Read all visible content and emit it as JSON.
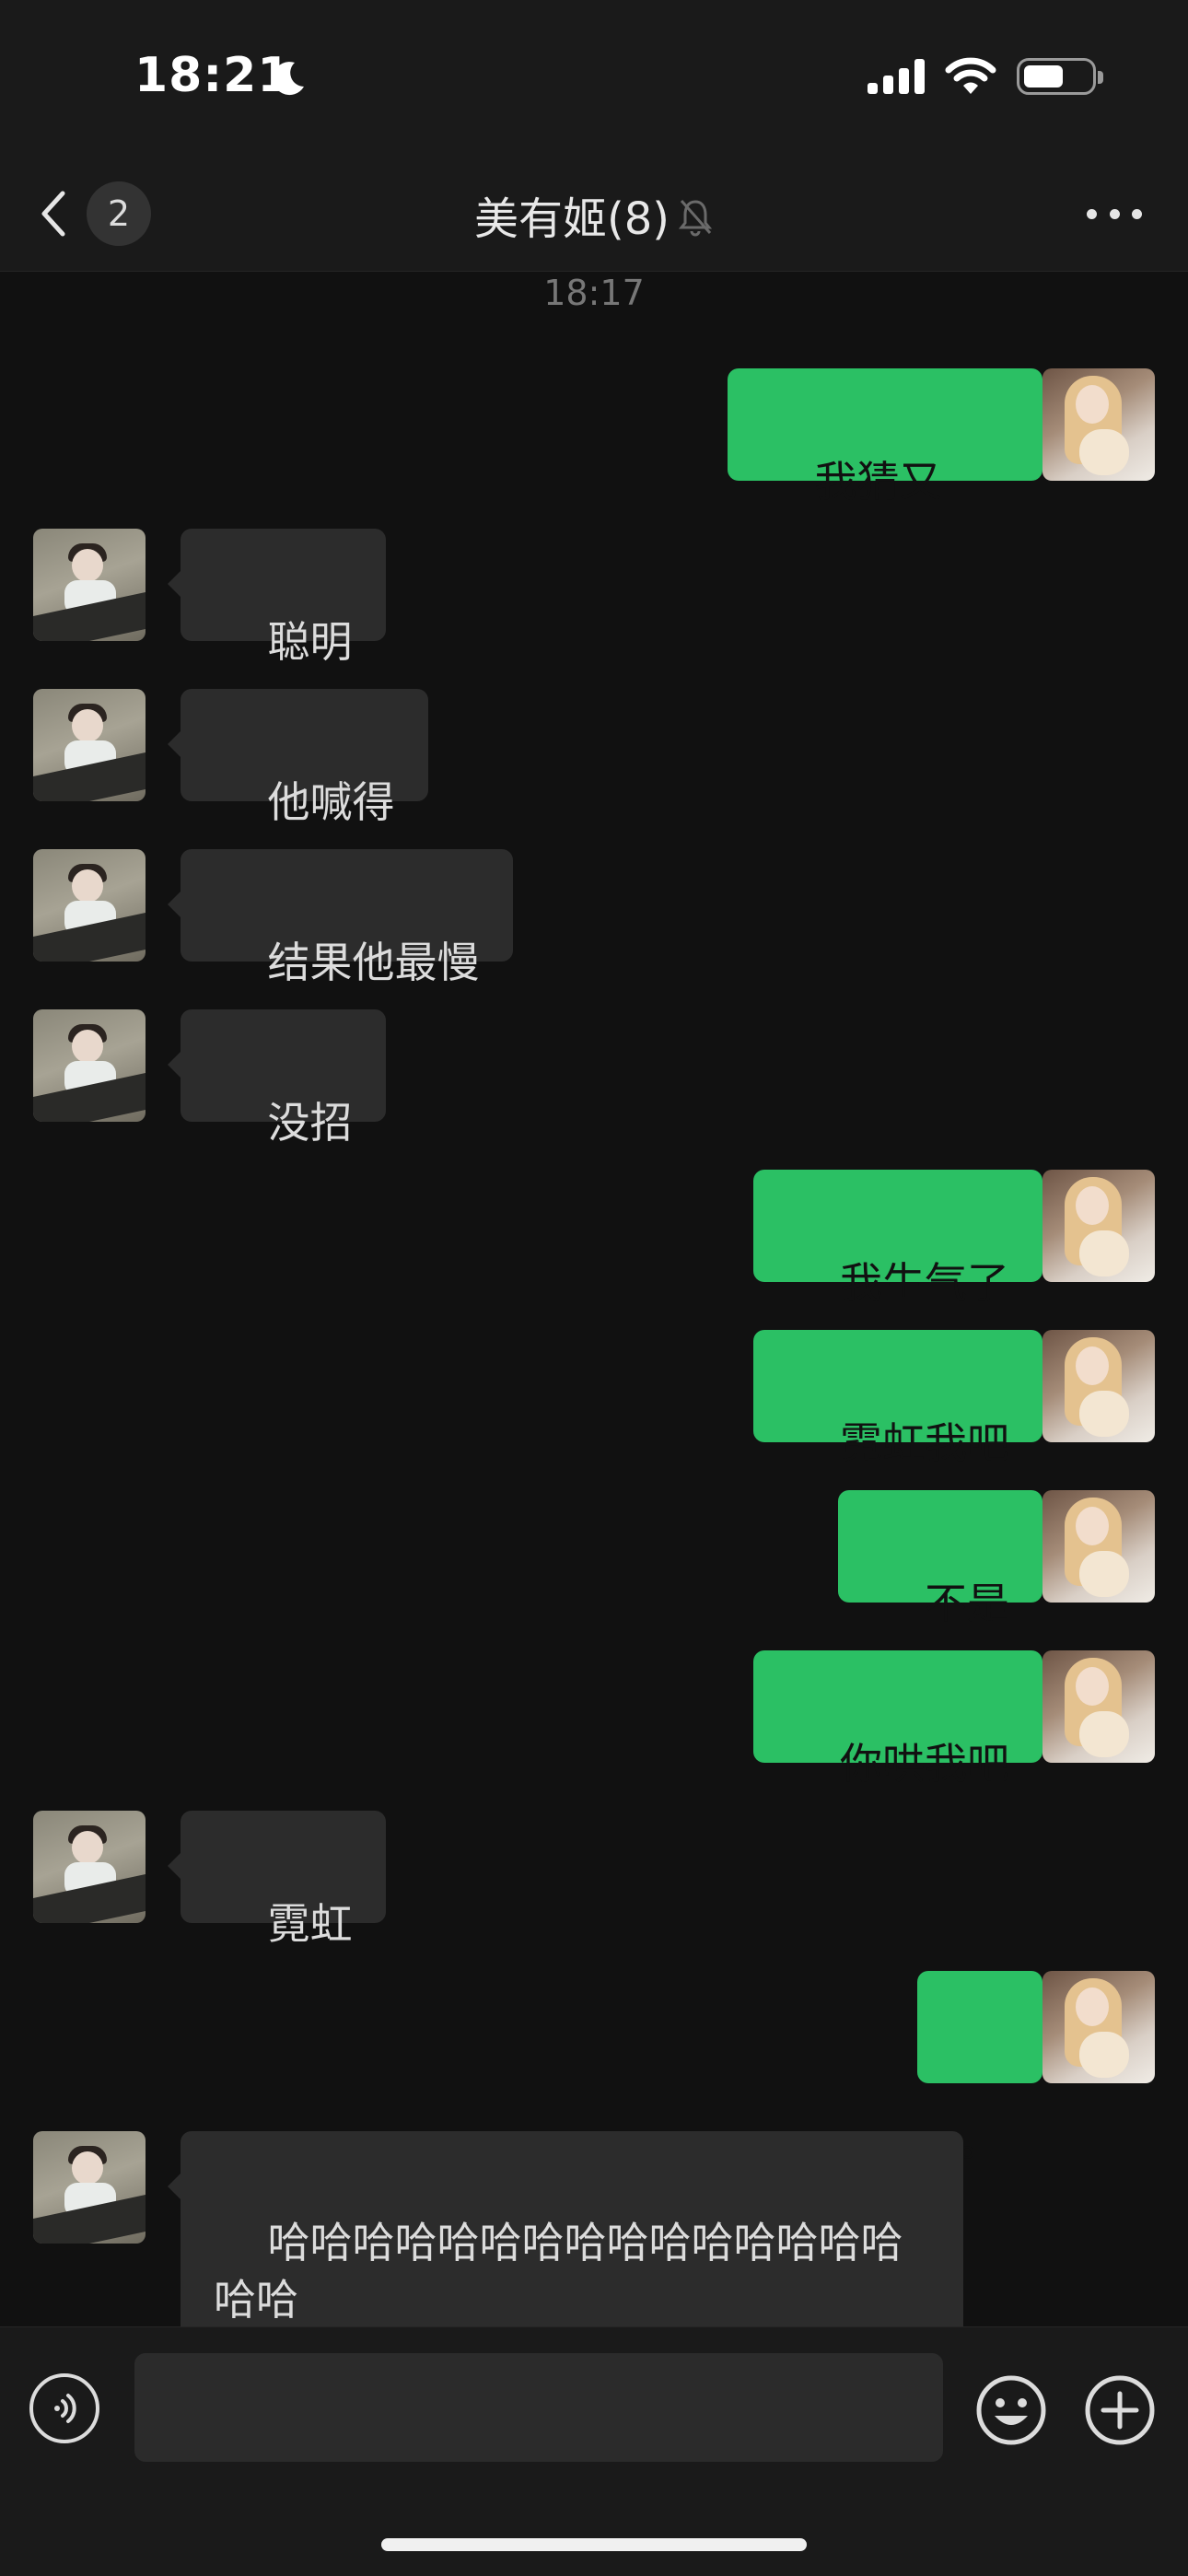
{
  "status_bar": {
    "time": "18:21"
  },
  "nav": {
    "back_badge": "2",
    "title": "美有姬(8)"
  },
  "chat": {
    "timestamp": "18:17",
    "messages": [
      {
        "side": "out",
        "text": "我猜又"
      },
      {
        "side": "in",
        "text": "聪明"
      },
      {
        "side": "in",
        "text": "他喊得"
      },
      {
        "side": "in",
        "text": "结果他最慢"
      },
      {
        "side": "in",
        "text": "没招"
      },
      {
        "side": "out",
        "text": "我生气了"
      },
      {
        "side": "out",
        "text": "霓虹我吧"
      },
      {
        "side": "out",
        "text": "不是"
      },
      {
        "side": "out",
        "text": "你哄我吧"
      },
      {
        "side": "in",
        "text": "霓虹"
      },
      {
        "side": "out",
        "text": "。"
      },
      {
        "side": "in",
        "text": "哈哈哈哈哈哈哈哈哈哈哈哈哈哈哈哈哈"
      }
    ]
  },
  "input": {
    "value": "",
    "placeholder": ""
  },
  "colors": {
    "sent_bubble": "#2bc064",
    "received_bubble": "#2c2c2c",
    "background": "#111111"
  }
}
